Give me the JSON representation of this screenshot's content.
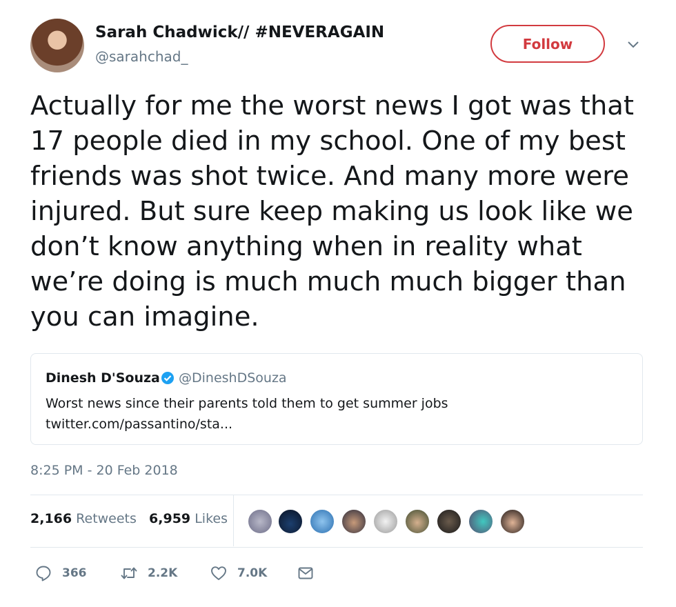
{
  "author": {
    "name": "Sarah Chadwick// #NEVERAGAIN",
    "handle": "@sarahchad_",
    "follow_label": "Follow"
  },
  "tweet_lines": [
    "Actually for me the worst news I got was that",
    "17 people died in my school. One of my best",
    "friends was shot twice. And many more were",
    "injured. But sure keep making us look like we",
    "don’t know anything when in reality what",
    "we’re doing is much much much bigger than",
    "you can imagine."
  ],
  "quoted": {
    "name": "Dinesh D'Souza",
    "handle": "@DineshDSouza",
    "text": "Worst news since their parents told them to get summer jobs",
    "link": "twitter.com/passantino/sta..."
  },
  "timestamp": "8:25 PM - 20 Feb 2018",
  "stats": {
    "retweets_count": "2,166",
    "retweets_label": "Retweets",
    "likes_count": "6,959",
    "likes_label": "Likes"
  },
  "actions": {
    "replies": "366",
    "retweets": "2.2K",
    "likes": "7.0K"
  },
  "colors": {
    "accent": "#d23a3f",
    "verified": "#1da1f2",
    "muted": "#657786"
  },
  "icons": [
    "chevron-down-icon",
    "verified-badge-icon",
    "reply-icon",
    "retweet-icon",
    "like-icon",
    "message-icon"
  ]
}
